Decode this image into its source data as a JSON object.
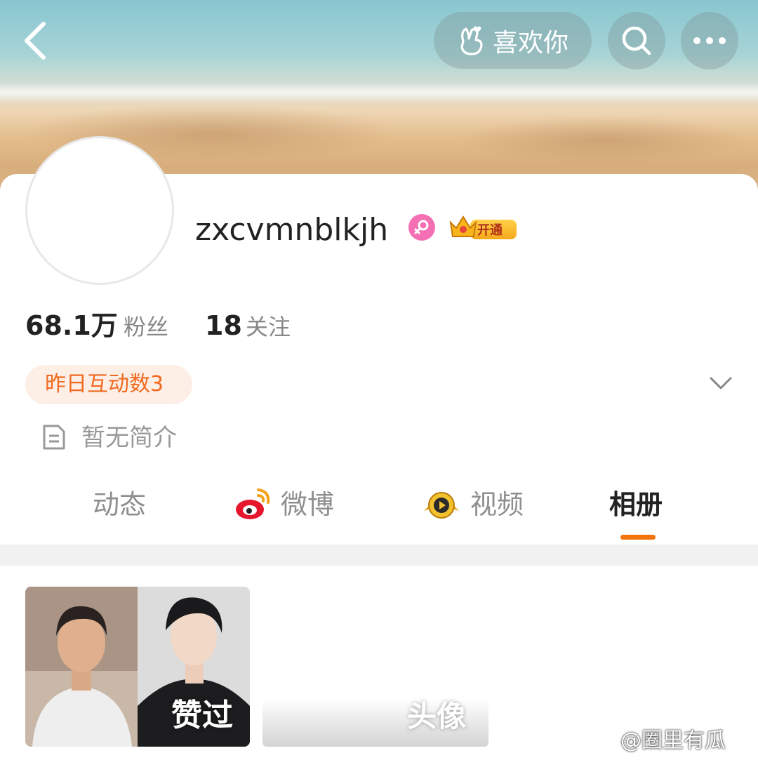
{
  "header": {
    "like_label": "喜欢你",
    "icons": [
      "back-arrow-icon",
      "hand-heart-icon",
      "search-icon",
      "more-icon"
    ]
  },
  "profile": {
    "username": "zxcvmnblkjh",
    "gender_icon": "female-icon",
    "vip_label": "开通",
    "followers_count": "68.1万",
    "followers_label": "粉丝",
    "following_count": "18",
    "following_label": "关注",
    "interaction_badge": "昨日互动数3",
    "bio": "暂无简介"
  },
  "tabs": [
    {
      "label": "动态",
      "active": false
    },
    {
      "label": "微博",
      "active": false,
      "icon": "weibo-icon"
    },
    {
      "label": "视频",
      "active": false,
      "icon": "video-badge-icon"
    },
    {
      "label": "相册",
      "active": true
    }
  ],
  "albums": [
    {
      "label": "赞过"
    },
    {
      "label": "头像"
    }
  ],
  "watermark": "@圈里有瓜",
  "colors": {
    "accent": "#f3740c",
    "badge_text": "#f06a20",
    "badge_bg": "#fdeee6",
    "female": "#f46fb4"
  }
}
